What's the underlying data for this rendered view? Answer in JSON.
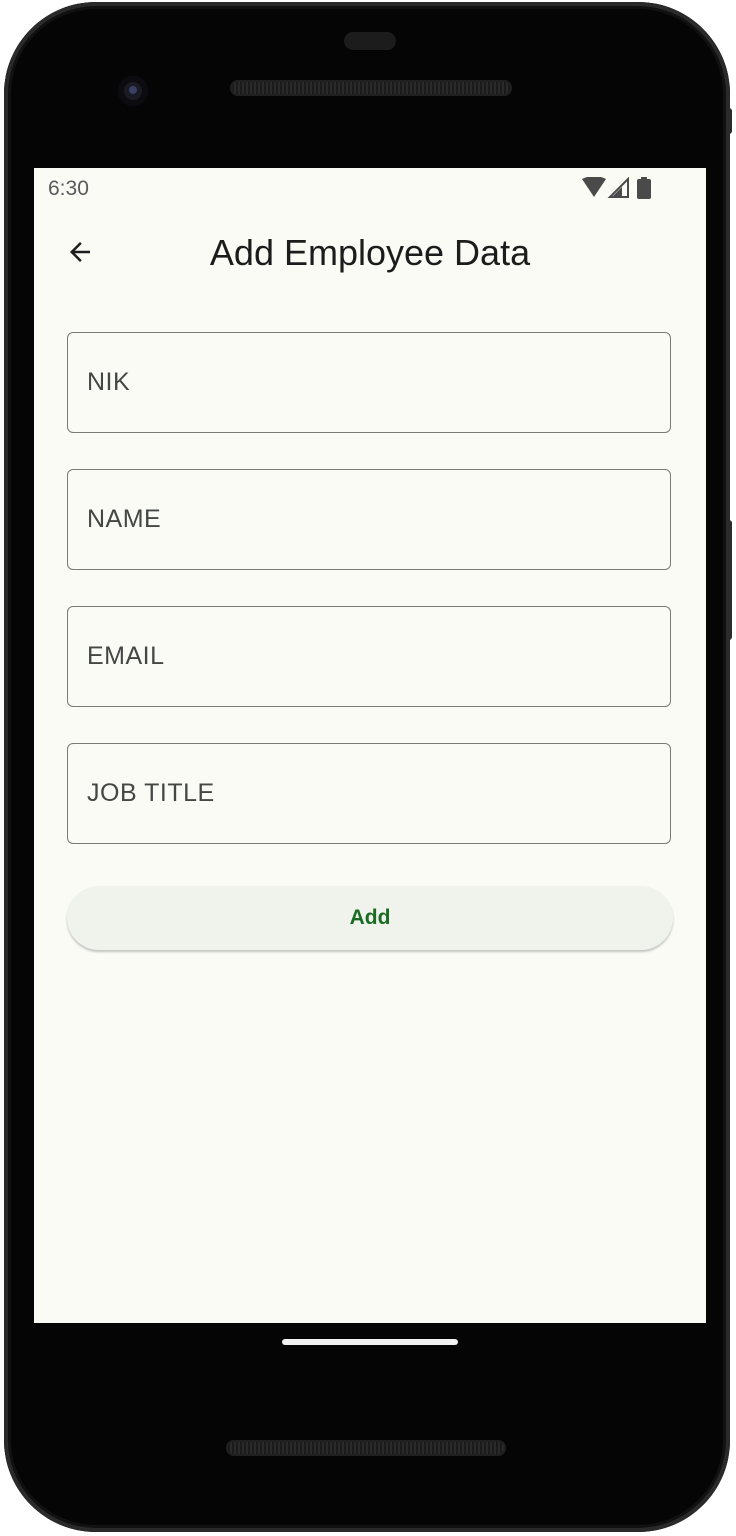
{
  "status_bar": {
    "time": "6:30",
    "icons": [
      "wifi-icon",
      "cell-signal-icon",
      "battery-icon"
    ]
  },
  "app_bar": {
    "back_icon": "arrow-back-icon",
    "title": "Add Employee Data"
  },
  "form": {
    "fields": [
      {
        "name": "nik",
        "placeholder": "NIK",
        "value": ""
      },
      {
        "name": "name",
        "placeholder": "NAME",
        "value": ""
      },
      {
        "name": "email",
        "placeholder": "EMAIL",
        "value": ""
      },
      {
        "name": "job_title",
        "placeholder": "JOB TITLE",
        "value": ""
      }
    ],
    "submit_label": "Add"
  },
  "colors": {
    "background": "#fafbf5",
    "button_bg": "#eff3ec",
    "button_text": "#1a6b23",
    "field_border": "#7a7a76"
  }
}
